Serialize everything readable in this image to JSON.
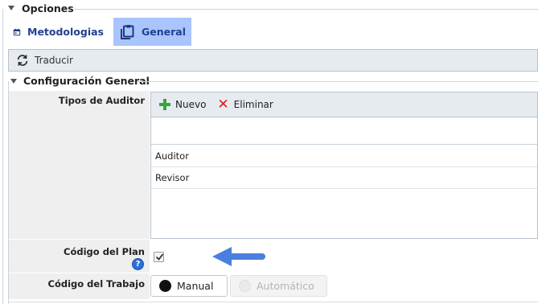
{
  "opciones": {
    "legend": "Opciones"
  },
  "tabs": [
    {
      "label": "Metodologias",
      "icon": "calendar-icon",
      "active": false
    },
    {
      "label": "General",
      "icon": "clipboard-icon",
      "active": true
    }
  ],
  "translate": {
    "label": "Traducir",
    "icon": "refresh-icon"
  },
  "config": {
    "legend": "Configuración General",
    "tipos_auditor": {
      "label": "Tipos de Auditor",
      "toolbar": {
        "new_label": "Nuevo",
        "delete_label": "Eliminar"
      },
      "filter_value": "",
      "rows": [
        "Auditor",
        "Revisor"
      ]
    },
    "codigo_plan": {
      "label": "Código del Plan",
      "checked": true,
      "help_glyph": "?"
    },
    "codigo_trabajo": {
      "label": "Código del Trabajo",
      "options": [
        "Manual",
        "Automático"
      ],
      "selected": "Manual"
    }
  },
  "colors": {
    "accent": "#23418f",
    "active_tab": "#a9c4ff",
    "arrow": "#4a7fe0",
    "add": "#3aa43a",
    "delete": "#d91c1c"
  }
}
